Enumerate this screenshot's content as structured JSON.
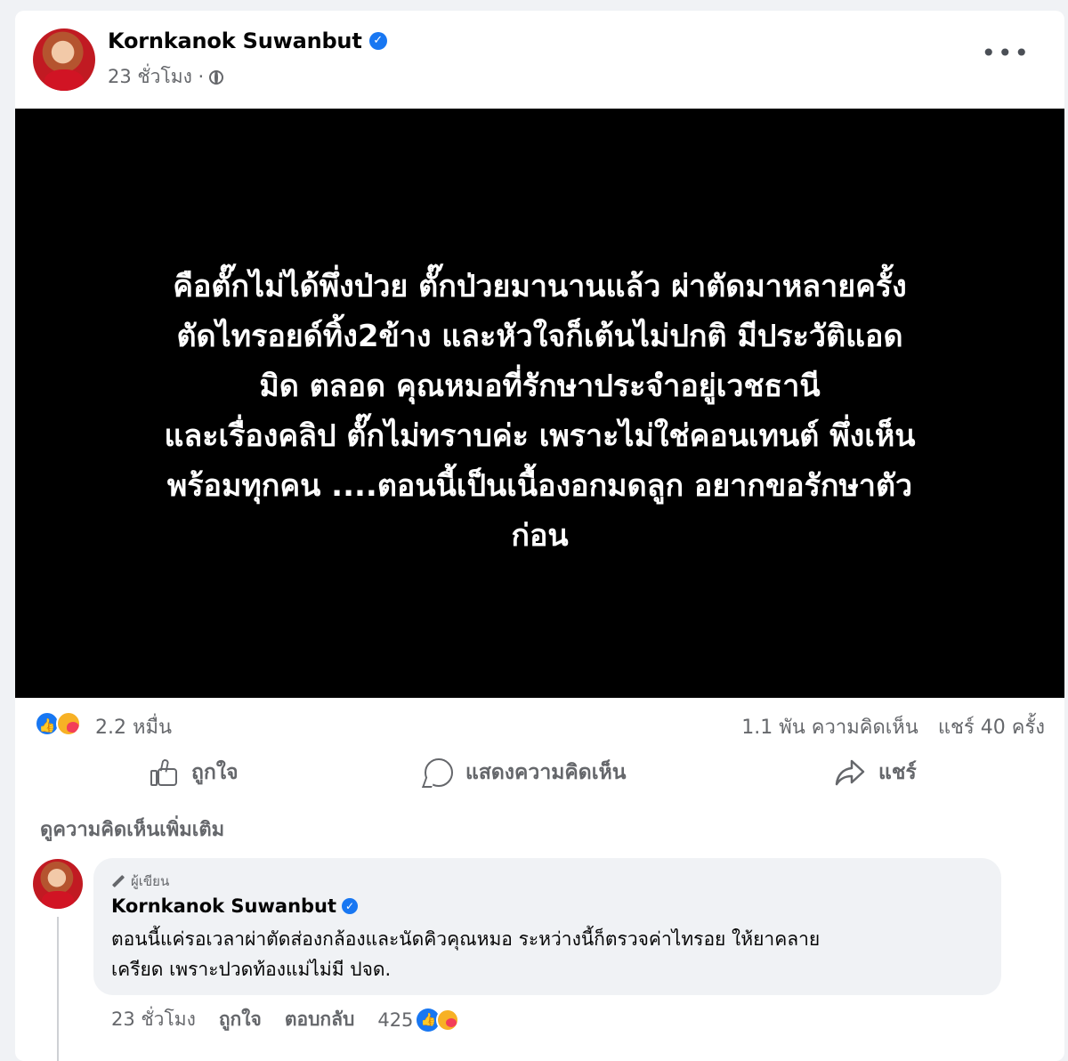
{
  "post": {
    "author": "Kornkanok Suwanbut",
    "time": "23 ชั่วโมง ·",
    "more": "•••",
    "body_text": "คือตั๊กไม่ได้พึ่งป่วย ตั๊กป่วยมานานแล้ว ผ่าตัดมาหลายครั้ง\nตัดไทรอยด์ทิ้ง2ข้าง และหัวใจก็เต้นไม่ปกติ มีประวัติแอด\nมิด ตลอด คุณหมอที่รักษาประจำอยู่เวชธานี\nและเรื่องคลิป ตั๊กไม่ทราบค่ะ เพราะไม่ใช่คอนเทนต์ พึ่งเห็น\nพร้อมทุกคน ....ตอนนี้เป็นเนื้องอกมดลูก อยากขอรักษาตัว\nก่อน",
    "body_bg": "#000000"
  },
  "stats": {
    "reactions": "2.2 หมื่น",
    "comments": "1.1 พัน ความคิดเห็น",
    "shares": "แชร์ 40 ครั้ง"
  },
  "actions": {
    "like": "ถูกใจ",
    "comment": "แสดงความคิดเห็น",
    "share": "แชร์"
  },
  "more_comments": "ดูความคิดเห็นเพิ่มเติม",
  "comment": {
    "badge": "ผู้เขียน",
    "author": "Kornkanok Suwanbut",
    "text": "ตอนนี้แค่รอเวลาผ่าตัดส่องกล้องและนัดคิวคุณหมอ ระหว่างนี้ก็ตรวจค่าไทรอย ให้ยาคลาย\nเครียด เพราะปวดท้องแม่ไม่มี ปจด.",
    "time": "23 ชั่วโมง",
    "like": "ถูกใจ",
    "reply": "ตอบกลับ",
    "reactions": "425"
  },
  "colors": {
    "accent": "#1877f2",
    "muted": "#65676b",
    "bubble": "#f0f2f5"
  },
  "icons": [
    "verified-icon",
    "globe-icon",
    "more-icon",
    "like-reaction-icon",
    "care-reaction-icon",
    "like-icon",
    "comment-icon",
    "share-icon",
    "pen-icon"
  ]
}
